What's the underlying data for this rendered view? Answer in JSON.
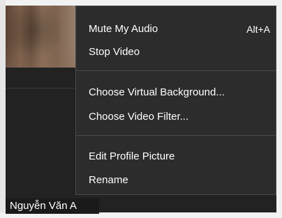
{
  "video": {
    "participant_name": "Nguyễn Văn A"
  },
  "menu": {
    "items": [
      {
        "label": "Mute My Audio",
        "shortcut": "Alt+A"
      },
      {
        "label": "Stop Video",
        "shortcut": ""
      },
      {
        "label": "Choose Virtual Background...",
        "shortcut": ""
      },
      {
        "label": "Choose Video Filter...",
        "shortcut": ""
      },
      {
        "label": "Edit Profile Picture",
        "shortcut": ""
      },
      {
        "label": "Rename",
        "shortcut": ""
      }
    ]
  }
}
